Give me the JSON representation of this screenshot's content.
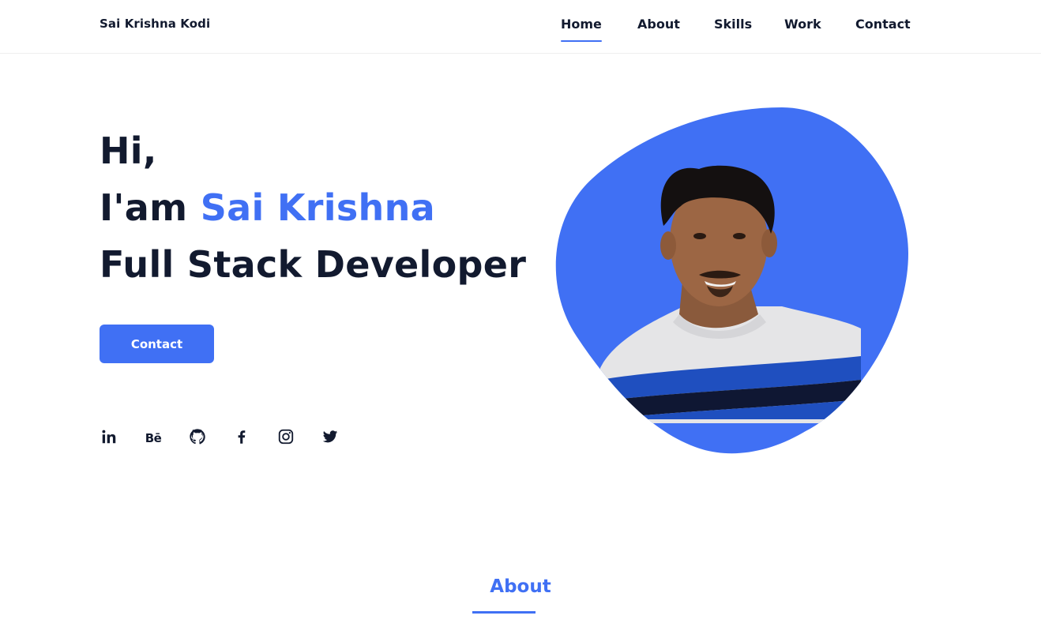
{
  "header": {
    "logo": "Sai Krishna Kodi",
    "nav": [
      {
        "label": "Home",
        "active": true
      },
      {
        "label": "About",
        "active": false
      },
      {
        "label": "Skills",
        "active": false
      },
      {
        "label": "Work",
        "active": false
      },
      {
        "label": "Contact",
        "active": false
      }
    ]
  },
  "hero": {
    "greeting": "Hi,",
    "intro_prefix": "I'am ",
    "name": "Sai Krishna",
    "role": "Full Stack Developer",
    "cta_label": "Contact"
  },
  "social": [
    {
      "icon": "linkedin-icon",
      "label": "in"
    },
    {
      "icon": "behance-icon",
      "label": "Bē"
    },
    {
      "icon": "github-icon"
    },
    {
      "icon": "facebook-icon"
    },
    {
      "icon": "instagram-icon"
    },
    {
      "icon": "twitter-icon"
    }
  ],
  "about": {
    "title": "About"
  },
  "colors": {
    "accent": "#4070f4",
    "text": "#121a2f",
    "background": "#ffffff"
  }
}
